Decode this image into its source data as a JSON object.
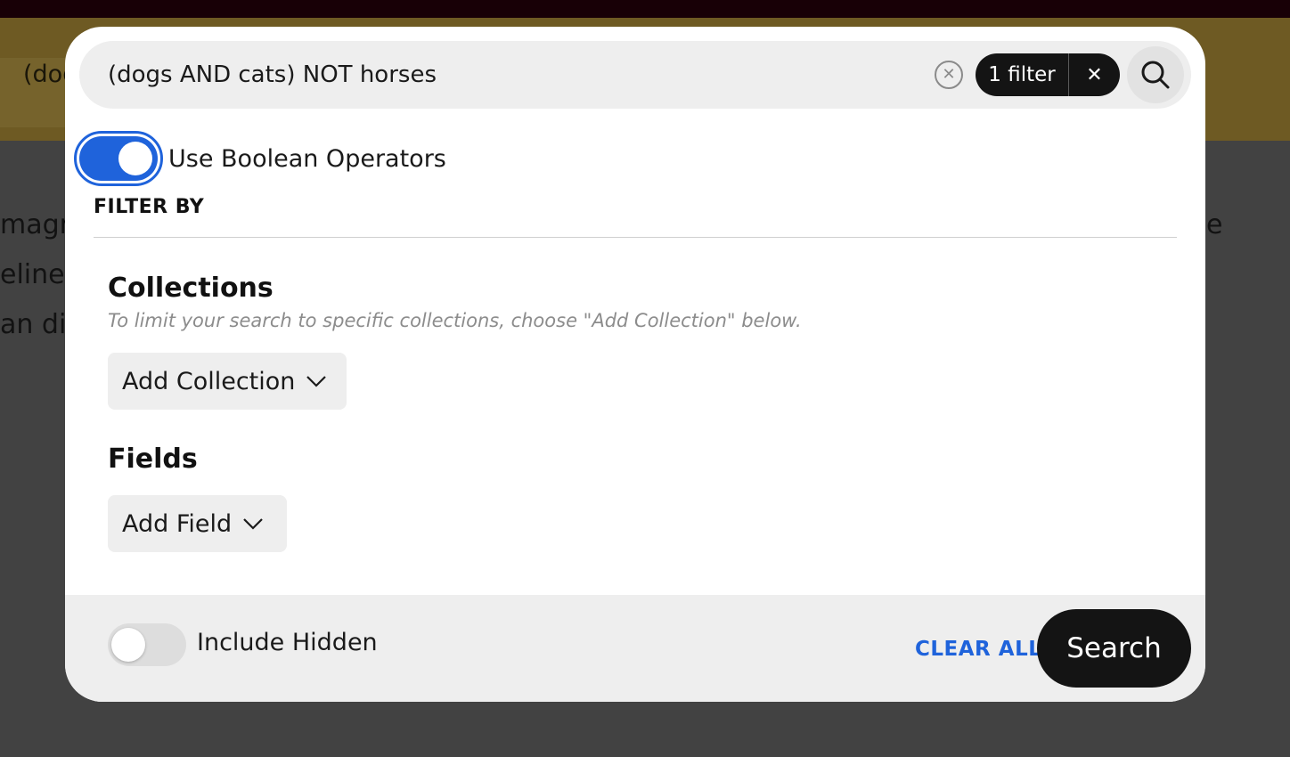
{
  "background": {
    "header_query_text": "(dog",
    "text_lines": [
      "magr",
      "eline\"",
      "an dis"
    ],
    "text_right": "e"
  },
  "search": {
    "query": "(dogs AND cats) NOT horses",
    "clear_icon": "close-circle-icon",
    "filter_chip_label": "1 filter",
    "filter_chip_close_icon": "close-icon",
    "submit_icon": "search-icon"
  },
  "boolean_toggle": {
    "label": "Use Boolean Operators",
    "checked": true
  },
  "filter_by": {
    "heading": "FILTER BY"
  },
  "collections": {
    "title": "Collections",
    "help": "To limit your search to specific collections, choose \"Add Collection\" below.",
    "dropdown_label": "Add Collection"
  },
  "fields": {
    "title": "Fields",
    "dropdown_label": "Add Field"
  },
  "footer": {
    "include_hidden_label": "Include Hidden",
    "include_hidden_checked": false,
    "clear_all_label": "CLEAR ALL",
    "search_button_label": "Search"
  },
  "colors": {
    "accent": "#1f63db",
    "dark": "#141414",
    "surface": "#eeeeee"
  }
}
